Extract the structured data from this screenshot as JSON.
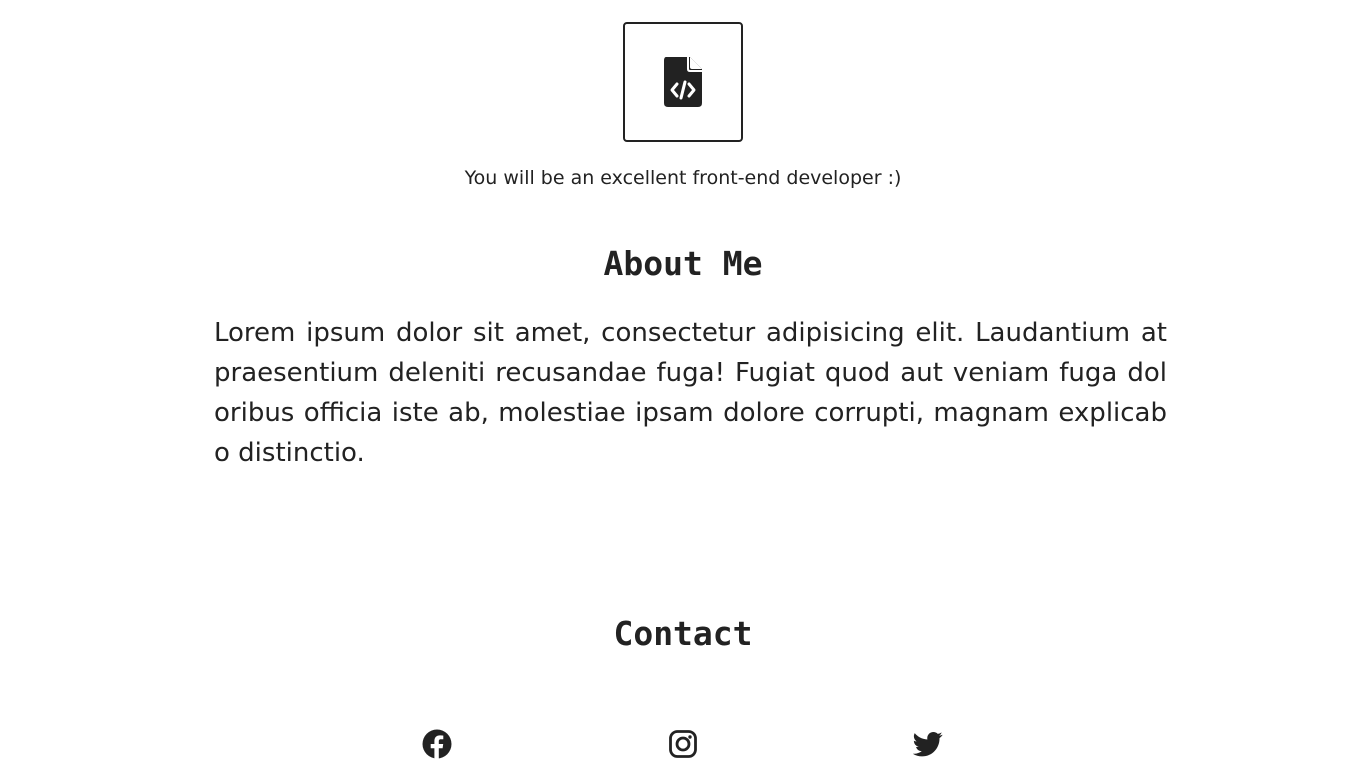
{
  "header": {
    "logo_icon": "file-code-icon",
    "tagline": "You will be an excellent front-end developer :)"
  },
  "about": {
    "title": "About Me",
    "text": "Lorem ipsum dolor sit amet, consectetur adipisicing elit. Laudantium at praesentium deleniti recusandae fuga! Fugiat quod aut veniam fuga doloribus officia iste ab, molestiae ipsam dolore corrupti, magnam explicabo distinctio."
  },
  "contact": {
    "title": "Contact",
    "links": [
      {
        "icon": "facebook-icon"
      },
      {
        "icon": "instagram-icon"
      },
      {
        "icon": "twitter-icon"
      }
    ]
  },
  "colors": {
    "text": "#222222",
    "background": "#ffffff"
  }
}
